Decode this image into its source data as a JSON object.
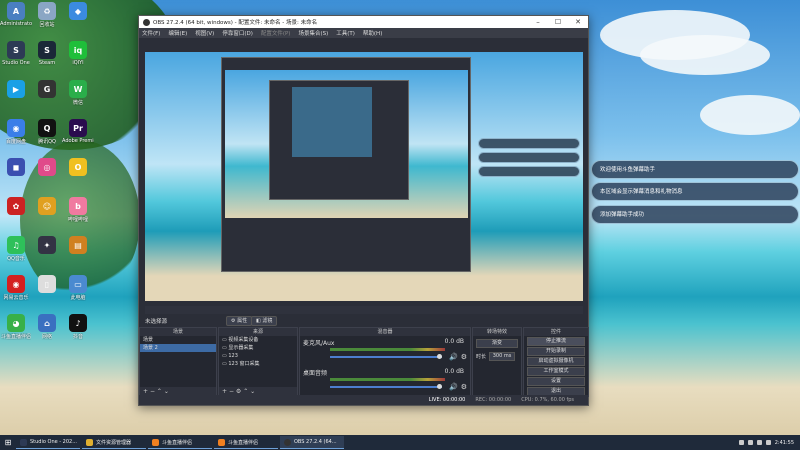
{
  "obs_window": {
    "title": "OBS 27.2.4 (64 bit, windows) - 配置文件: 未命名 - 场景: 未命名",
    "menu": [
      "文件(F)",
      "编辑(E)",
      "视图(V)",
      "停靠窗口(D)",
      "配置文件(P)",
      "场景集合(S)",
      "工具(T)",
      "帮助(H)"
    ],
    "no_source_label": "未选择源",
    "properties_label": "属性",
    "filters_label": "滤镜",
    "scenes": {
      "header": "场景",
      "items": [
        "场景",
        "场景 2"
      ],
      "selected": 1
    },
    "sources": {
      "header": "来源",
      "items": [
        "视频采集设备",
        "显示器采集",
        "123",
        "123 窗口采集"
      ]
    },
    "mixer": {
      "header": "混音器",
      "tracks": [
        {
          "name": "麦克风/Aux",
          "db": "0.0 dB"
        },
        {
          "name": "桌面音频",
          "db": "0.0 dB"
        }
      ]
    },
    "transitions": {
      "header": "转场特效",
      "type": "渐变",
      "duration_label": "时长",
      "duration": "300 ms"
    },
    "controls": {
      "header": "控件",
      "buttons": [
        "停止推流",
        "开始录制",
        "启动虚拟摄像机",
        "工作室模式",
        "设置",
        "退出"
      ]
    },
    "status": {
      "live": "LIVE: 00:00:00",
      "rec": "REC: 00:00:00",
      "cpu": "CPU: 0.7%, 60.00 fps"
    }
  },
  "notifications": {
    "large": [
      "欢迎使用斗鱼弹幕助手",
      "本区域会显示弹幕消息和礼物消息",
      "添加弹幕助手成功"
    ]
  },
  "desktop_icons": [
    {
      "label": "Administrator",
      "color": "#4a7fc1",
      "glyph": "A"
    },
    {
      "label": "回收站",
      "color": "#8aa6c4",
      "glyph": "♻"
    },
    {
      "label": "",
      "color": "#3b8be0",
      "glyph": "◆"
    },
    {
      "label": "Studio One",
      "color": "#2d3a55",
      "glyph": "S"
    },
    {
      "label": "Steam",
      "color": "#1b2838",
      "glyph": "S"
    },
    {
      "label": "iQIYI",
      "color": "#1fbf3a",
      "glyph": "iq"
    },
    {
      "label": "",
      "color": "#1aa0e6",
      "glyph": "▶"
    },
    {
      "label": "",
      "color": "#333",
      "glyph": "G"
    },
    {
      "label": "微信",
      "color": "#2aae4a",
      "glyph": "W"
    },
    {
      "label": "百度网盘",
      "color": "#3a7ee8",
      "glyph": "◉"
    },
    {
      "label": "腾讯QQ",
      "color": "#111",
      "glyph": "Q"
    },
    {
      "label": "Adobe Premiere",
      "color": "#2a0c4e",
      "glyph": "Pr"
    },
    {
      "label": "",
      "color": "#3b4fb0",
      "glyph": "◼"
    },
    {
      "label": "",
      "color": "#e04a8a",
      "glyph": "◎"
    },
    {
      "label": "",
      "color": "#f0c020",
      "glyph": "O"
    },
    {
      "label": "",
      "color": "#c22",
      "glyph": "✿"
    },
    {
      "label": "",
      "color": "#e0a020",
      "glyph": "☺"
    },
    {
      "label": "哔哩哔哩",
      "color": "#f07aa0",
      "glyph": "b"
    },
    {
      "label": "QQ音乐",
      "color": "#2ec05a",
      "glyph": "♫"
    },
    {
      "label": "",
      "color": "#334",
      "glyph": "✦"
    },
    {
      "label": "",
      "color": "#d08020",
      "glyph": "▤"
    },
    {
      "label": "网易云音乐",
      "color": "#d42020",
      "glyph": "◉"
    },
    {
      "label": "",
      "color": "#ddd",
      "glyph": "▯"
    },
    {
      "label": "此电脑",
      "color": "#4a8ad0",
      "glyph": "▭"
    },
    {
      "label": "斗鱼直播伴侣",
      "color": "#38b048",
      "glyph": "◕"
    },
    {
      "label": "网络",
      "color": "#3a70c0",
      "glyph": "⌂"
    },
    {
      "label": "抖音",
      "color": "#111",
      "glyph": "♪"
    }
  ],
  "taskbar": {
    "items": [
      "Studio One - 202...",
      "文件资源管理器",
      "斗鱼直播伴侣",
      "斗鱼直播伴侣",
      "OBS 27.2.4 (64..."
    ],
    "time": "2:41:55"
  }
}
